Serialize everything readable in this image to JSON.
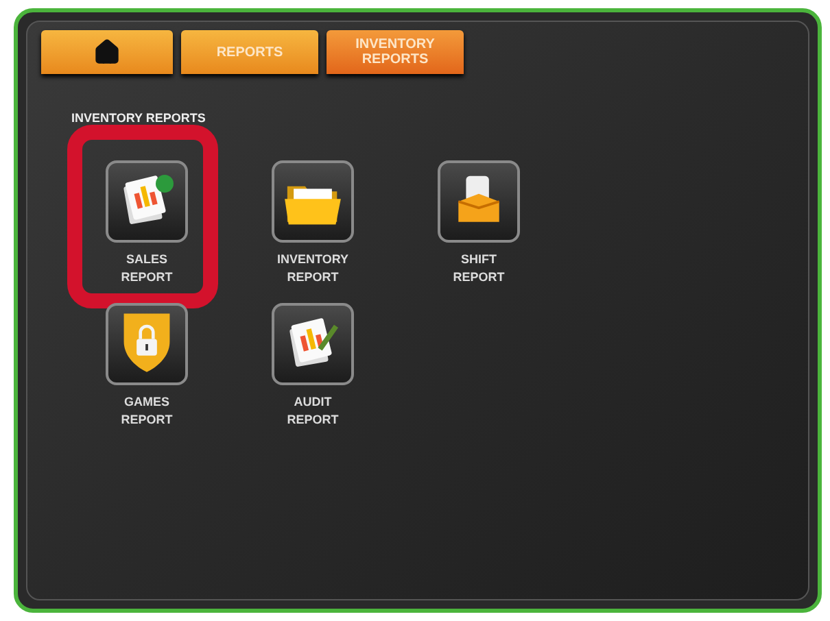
{
  "tabs": [
    {
      "kind": "home",
      "selected": false
    },
    {
      "kind": "text",
      "label": "REPORTS",
      "selected": false
    },
    {
      "kind": "text",
      "label": "INVENTORY REPORTS",
      "selected": true
    }
  ],
  "section_title": "INVENTORY REPORTS",
  "reports": [
    {
      "kind": "sales",
      "label": "SALES REPORT",
      "highlighted": true
    },
    {
      "kind": "inventory",
      "label": "INVENTORY REPORT",
      "highlighted": false
    },
    {
      "kind": "shift",
      "label": "SHIFT REPORT",
      "highlighted": false
    },
    {
      "kind": "games",
      "label": "GAMES REPORT",
      "highlighted": false
    },
    {
      "kind": "audit",
      "label": "AUDIT REPORT",
      "highlighted": false
    }
  ]
}
